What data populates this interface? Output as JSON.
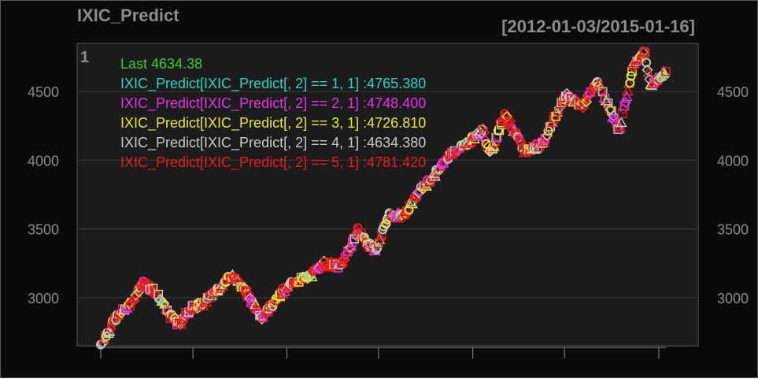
{
  "colors": {
    "background": "#0a0a0a",
    "panel": "#1c1c1c",
    "grid": "#3a3a3a",
    "axis": "#8a8a8a",
    "title": "#8c8c8c",
    "series1": "#29d2c8",
    "series2": "#e632e6",
    "series3": "#e6e632",
    "series4": "#c8c8c8",
    "series5": "#e61e1e",
    "last": "#33cc33",
    "square": "#9ed09e"
  },
  "chart_data": {
    "type": "line",
    "title": "IXIC_Predict",
    "date_range": "[2012-01-03/2015-01-16]",
    "panel_label": "1",
    "ylim": [
      2650,
      4850
    ],
    "yticks": [
      3000,
      3500,
      4000,
      4500
    ],
    "ytick_labels": [
      "3000",
      "3500",
      "4000",
      "4500"
    ],
    "grid": true,
    "legend_position": "top-left",
    "legend": [
      {
        "text": "Last 4634.38",
        "color_key": "last"
      },
      {
        "text": "IXIC_Predict[IXIC_Predict[, 2] == 1, 1] :4765.380",
        "color_key": "series1"
      },
      {
        "text": "IXIC_Predict[IXIC_Predict[, 2] == 2, 1] :4748.400",
        "color_key": "series2"
      },
      {
        "text": "IXIC_Predict[IXIC_Predict[, 2] == 3, 1] :4726.810",
        "color_key": "series3"
      },
      {
        "text": "IXIC_Predict[IXIC_Predict[, 2] == 4, 1] :4634.380",
        "color_key": "series4"
      },
      {
        "text": "IXIC_Predict[IXIC_Predict[, 2] == 5, 1] :4781.420",
        "color_key": "series5"
      }
    ],
    "x": [
      "2012-01-03",
      "2012-02-01",
      "2012-03-01",
      "2012-03-27",
      "2012-04-15",
      "2012-05-01",
      "2012-05-20",
      "2012-06-05",
      "2012-06-25",
      "2012-07-20",
      "2012-08-15",
      "2012-09-19",
      "2012-10-10",
      "2012-11-15",
      "2012-12-15",
      "2013-01-15",
      "2013-02-15",
      "2013-03-15",
      "2013-04-18",
      "2013-05-21",
      "2013-06-24",
      "2013-07-20",
      "2013-08-20",
      "2013-09-20",
      "2013-10-20",
      "2013-11-20",
      "2013-12-20",
      "2014-01-22",
      "2014-02-05",
      "2014-03-06",
      "2014-04-14",
      "2014-05-20",
      "2014-06-20",
      "2014-07-03",
      "2014-08-07",
      "2014-09-03",
      "2014-10-16",
      "2014-11-14",
      "2014-12-05",
      "2014-12-16",
      "2015-01-16"
    ],
    "y": [
      2660,
      2850,
      2960,
      3110,
      3060,
      2980,
      2860,
      2800,
      2920,
      2950,
      3050,
      3170,
      3060,
      2860,
      3000,
      3120,
      3150,
      3250,
      3230,
      3490,
      3330,
      3600,
      3600,
      3780,
      3900,
      4050,
      4120,
      4220,
      4040,
      4340,
      4060,
      4130,
      4380,
      4470,
      4400,
      4580,
      4220,
      4700,
      4790,
      4550,
      4634
    ]
  }
}
